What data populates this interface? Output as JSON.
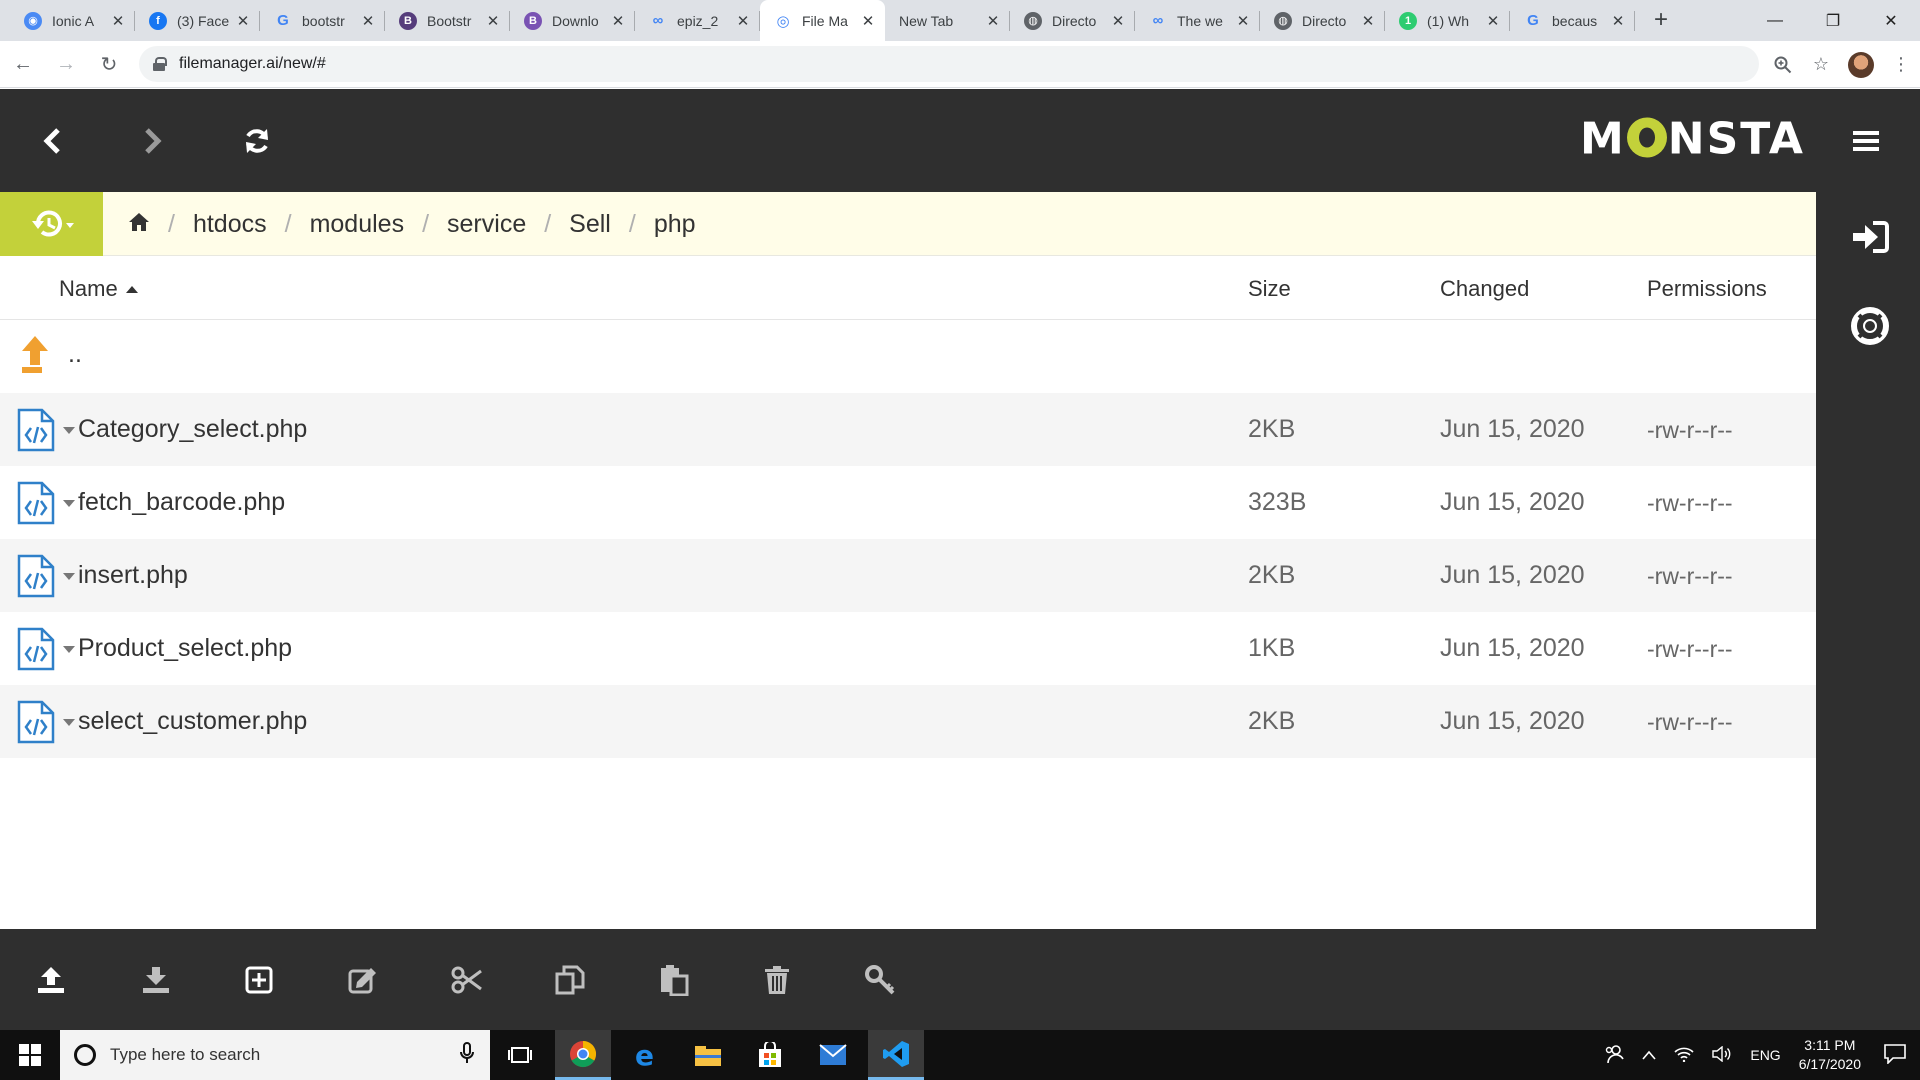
{
  "browser": {
    "tabs": [
      {
        "label": "Ionic A",
        "fav_color": "#4a8af4",
        "fav_glyph": "◉"
      },
      {
        "label": "(3) Face",
        "fav_color": "#1877f2",
        "fav_glyph": "f"
      },
      {
        "label": "bootstr",
        "fav_color": "#ffffff",
        "fav_glyph": "G"
      },
      {
        "label": "Bootstr",
        "fav_color": "#563d7c",
        "fav_glyph": "B"
      },
      {
        "label": "Downlo",
        "fav_color": "#7952b3",
        "fav_glyph": "B"
      },
      {
        "label": "epiz_2",
        "fav_color": "#ffffff",
        "fav_glyph": "∞"
      },
      {
        "label": "File Ma",
        "fav_color": "#ffffff",
        "fav_glyph": "◎",
        "active": true
      },
      {
        "label": "New Tab",
        "fav_color": "",
        "fav_glyph": ""
      },
      {
        "label": "Directo",
        "fav_color": "#5f6368",
        "fav_glyph": "◍"
      },
      {
        "label": "The we",
        "fav_color": "#ffffff",
        "fav_glyph": "∞"
      },
      {
        "label": "Directo",
        "fav_color": "#5f6368",
        "fav_glyph": "◍"
      },
      {
        "label": "(1) Wh",
        "fav_color": "#2ecc71",
        "fav_glyph": "1"
      },
      {
        "label": "becaus",
        "fav_color": "#ffffff",
        "fav_glyph": "G"
      }
    ],
    "new_tab_glyph": "+",
    "url": "filemanager.ai/new/#",
    "close_glyph": "✕"
  },
  "app": {
    "brand": "MONSTA",
    "brand_left": "M",
    "brand_right": "NSTA",
    "colors": {
      "accent": "#c3d13a",
      "dark": "#2f2f2f",
      "breadcrumb_bg": "#fffde8",
      "icon_blue": "#2f80c9",
      "up_orange": "#f0a030"
    },
    "breadcrumb": [
      "htdocs",
      "modules",
      "service",
      "Sell",
      "php"
    ],
    "columns": {
      "name": "Name",
      "size": "Size",
      "changed": "Changed",
      "permissions": "Permissions"
    },
    "parent_dir": "..",
    "files": [
      {
        "name": "Category_select.php",
        "size": "2KB",
        "changed": "Jun 15, 2020",
        "permissions": "-rw-r--r--"
      },
      {
        "name": "fetch_barcode.php",
        "size": "323B",
        "changed": "Jun 15, 2020",
        "permissions": "-rw-r--r--"
      },
      {
        "name": "insert.php",
        "size": "2KB",
        "changed": "Jun 15, 2020",
        "permissions": "-rw-r--r--"
      },
      {
        "name": "Product_select.php",
        "size": "1KB",
        "changed": "Jun 15, 2020",
        "permissions": "-rw-r--r--"
      },
      {
        "name": "select_customer.php",
        "size": "2KB",
        "changed": "Jun 15, 2020",
        "permissions": "-rw-r--r--"
      }
    ]
  },
  "taskbar": {
    "search_placeholder": "Type here to search",
    "language": "ENG",
    "time": "3:11 PM",
    "date": "6/17/2020"
  }
}
